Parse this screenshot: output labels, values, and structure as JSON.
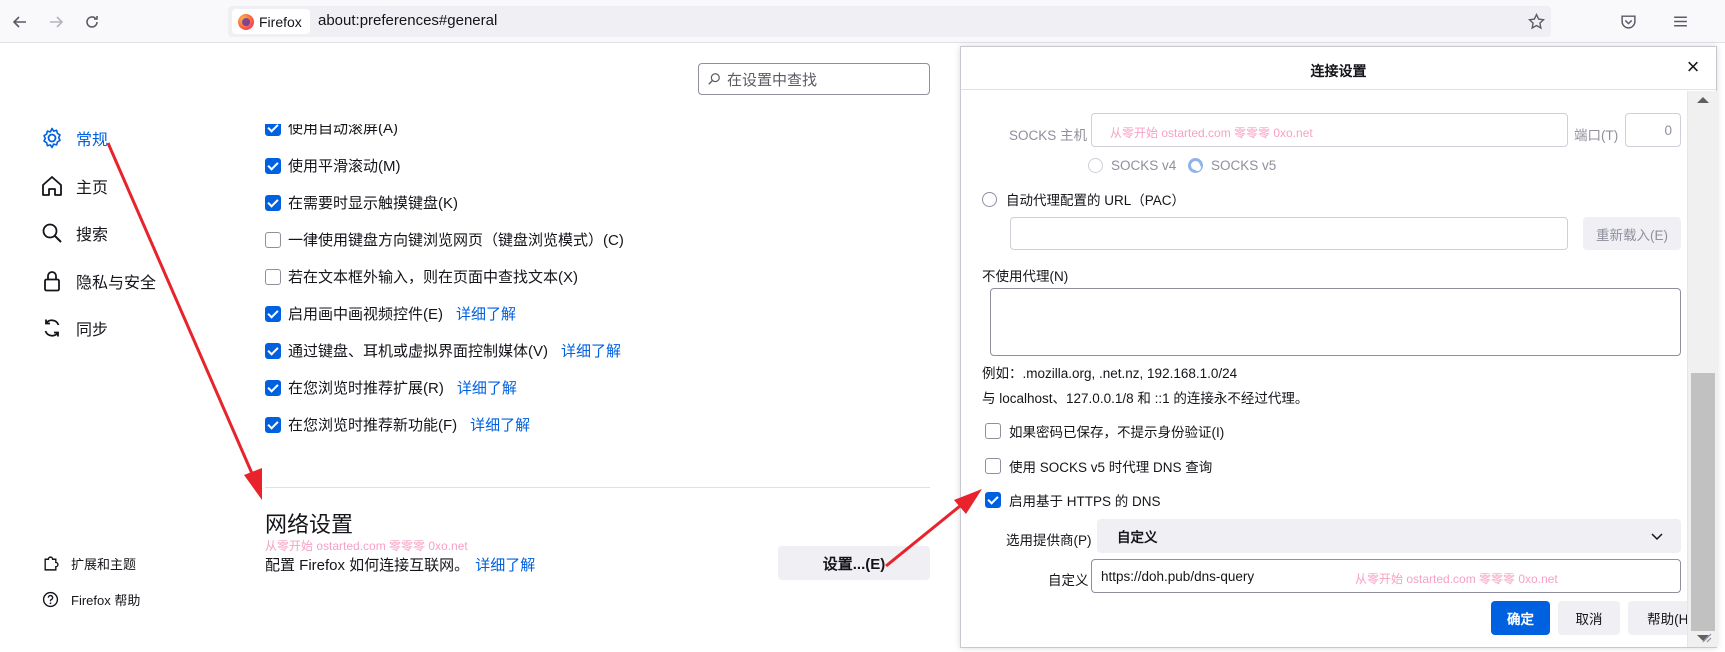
{
  "browser": {
    "identity_label": "Firefox",
    "url": "about:preferences#general"
  },
  "sidebar": {
    "items": [
      {
        "label": "常规",
        "icon": "gear-icon"
      },
      {
        "label": "主页",
        "icon": "home-icon"
      },
      {
        "label": "搜索",
        "icon": "search-icon"
      },
      {
        "label": "隐私与安全",
        "icon": "lock-icon"
      },
      {
        "label": "同步",
        "icon": "sync-icon"
      }
    ],
    "footer": [
      {
        "label": "扩展和主题",
        "icon": "puzzle-icon"
      },
      {
        "label": "Firefox 帮助",
        "icon": "help-icon"
      }
    ]
  },
  "search": {
    "placeholder": "在设置中查找"
  },
  "options": [
    {
      "label": "使用自动滚屏(A)",
      "checked": true,
      "link": ""
    },
    {
      "label": "使用平滑滚动(M)",
      "checked": true,
      "link": ""
    },
    {
      "label": "在需要时显示触摸键盘(K)",
      "checked": true,
      "link": ""
    },
    {
      "label": "一律使用键盘方向键浏览网页（键盘浏览模式）(C)",
      "checked": false,
      "link": ""
    },
    {
      "label": "若在文本框外输入，则在页面中查找文本(X)",
      "checked": false,
      "link": ""
    },
    {
      "label": "启用画中画视频控件(E)",
      "checked": true,
      "link": "详细了解"
    },
    {
      "label": "通过键盘、耳机或虚拟界面控制媒体(V)",
      "checked": true,
      "link": "详细了解"
    },
    {
      "label": "在您浏览时推荐扩展(R)",
      "checked": true,
      "link": "详细了解"
    },
    {
      "label": "在您浏览时推荐新功能(F)",
      "checked": true,
      "link": "详细了解"
    }
  ],
  "network": {
    "title": "网络设置",
    "watermark": "从零开始 ostarted.com 零零零 0xo.net",
    "description": "配置 Firefox 如何连接互联网。",
    "link": "详细了解",
    "settings_button": "设置...(E)"
  },
  "dialog": {
    "title": "连接设置",
    "socks_host_label": "SOCKS 主机",
    "socks_host_value": "从零开始 ostarted.com 零零零 0xo.net",
    "port_label": "端口(T)",
    "port_value": "0",
    "socks_v4": "SOCKS v4",
    "socks_v5": "SOCKS v5",
    "pac_label": "自动代理配置的 URL（PAC）",
    "reload_button": "重新载入(E)",
    "no_proxy_label": "不使用代理(N)",
    "example": "例如：.mozilla.org, .net.nz, 192.168.1.0/24",
    "localhost_note": "与 localhost、127.0.0.1/8 和 ::1 的连接永不经过代理。",
    "no_prompt_auth": "如果密码已保存，不提示身份验证(I)",
    "socks_dns": "使用 SOCKS v5 时代理 DNS 查询",
    "https_dns": "启用基于 HTTPS 的 DNS",
    "provider_label": "选用提供商(P)",
    "provider_value": "自定义",
    "custom_label": "自定义",
    "custom_value": "https://doh.pub/dns-query",
    "custom_watermark": "从零开始 ostarted.com 零零零 0xo.net",
    "ok_button": "确定",
    "cancel_button": "取消",
    "help_button": "帮助(H)"
  },
  "colors": {
    "accent": "#0061e0",
    "arrow": "#e8232b",
    "watermark": "#f7a1c4"
  }
}
